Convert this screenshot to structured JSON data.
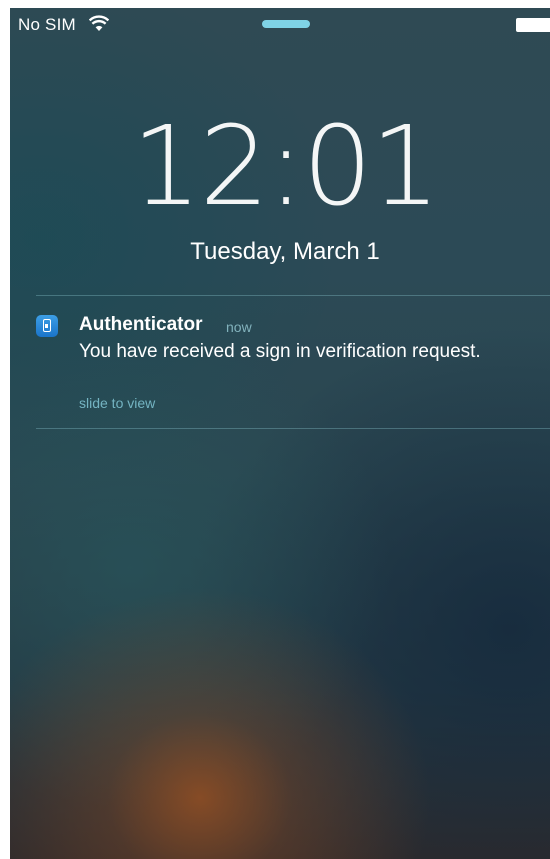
{
  "status_bar": {
    "carrier": "No SIM",
    "wifi_icon": "wifi-icon",
    "battery_icon": "battery-icon"
  },
  "lock_screen": {
    "time": "12:01",
    "date": "Tuesday, March 1"
  },
  "notification": {
    "app_icon": "authenticator-app-icon",
    "app_name": "Authenticator",
    "time": "now",
    "message": "You have received a sign in verification request.",
    "action_hint": "slide to view"
  },
  "colors": {
    "grabber": "#7fd3e6",
    "hint_text": "#78b9c8",
    "app_icon": "#2a8ad8"
  }
}
